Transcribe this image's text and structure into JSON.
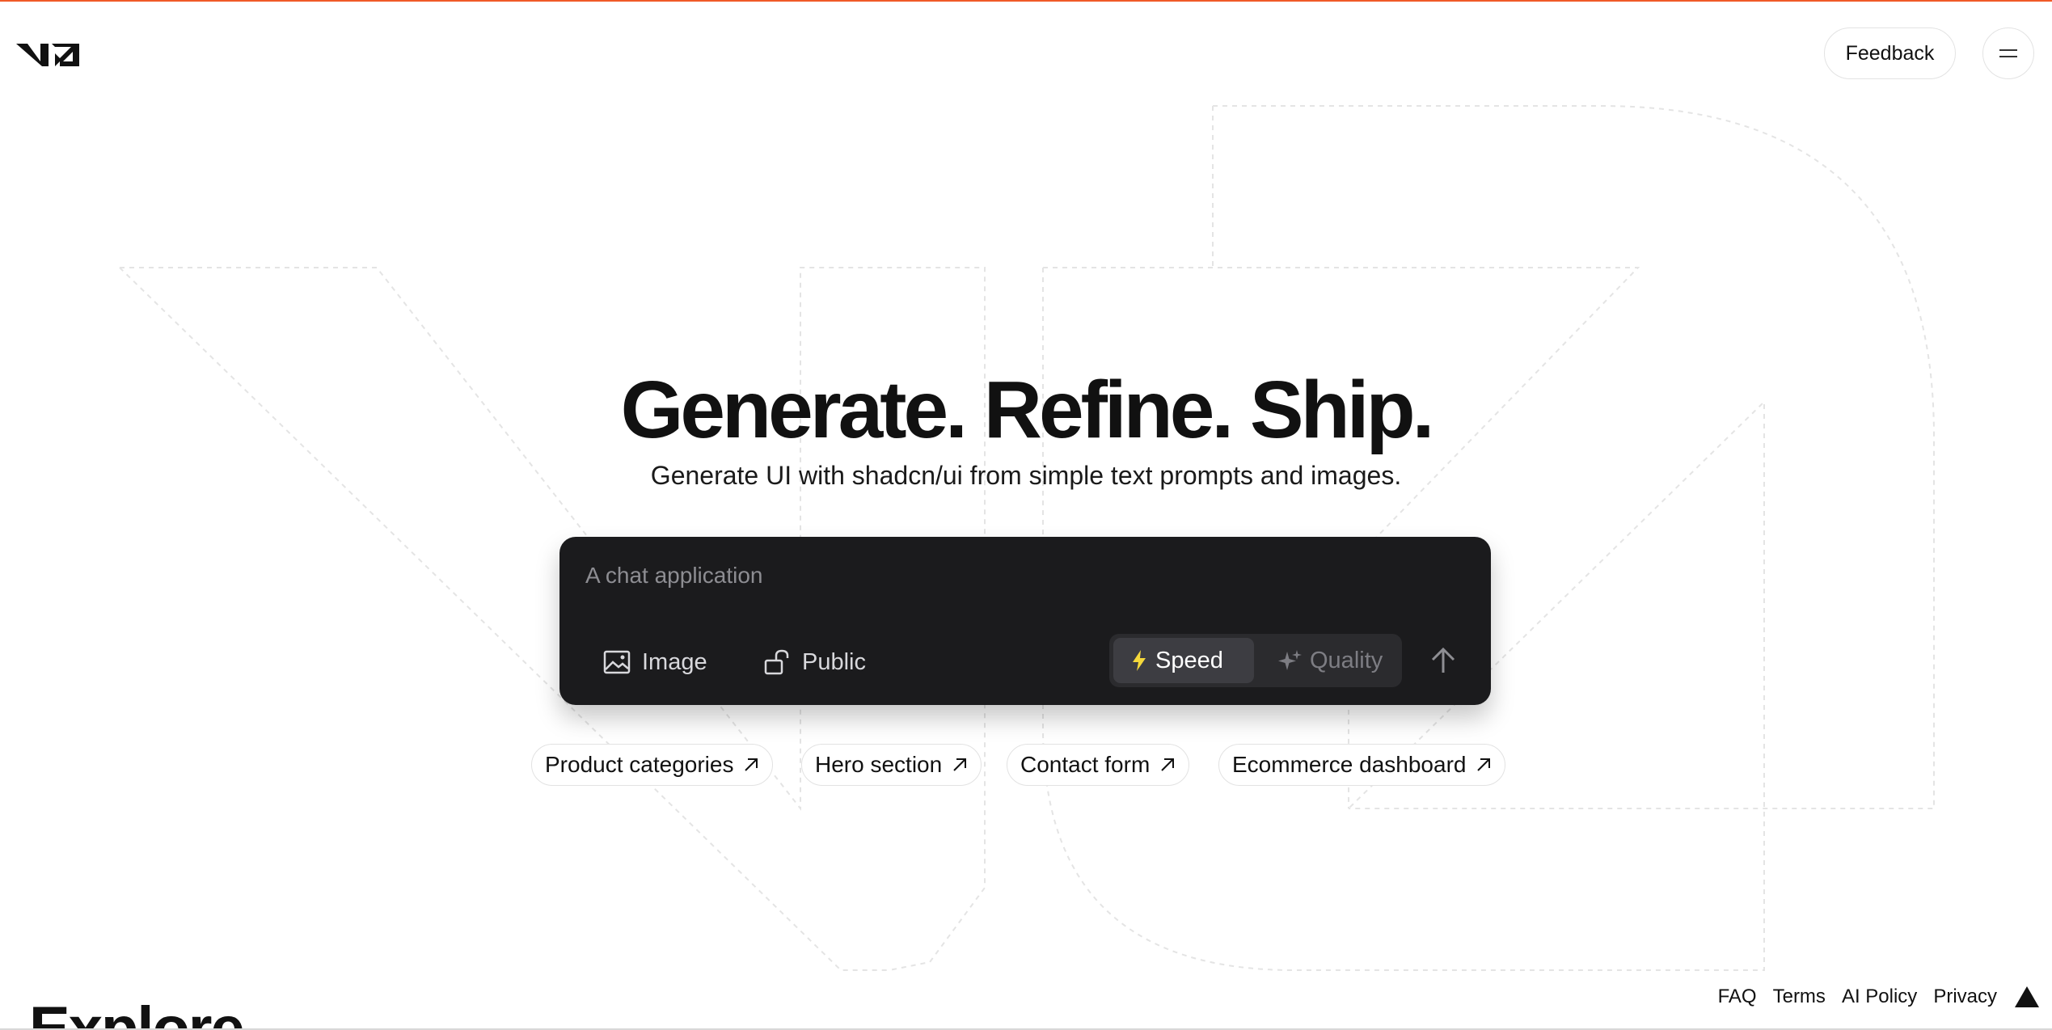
{
  "header": {
    "logo_icon": "v0-logo-icon",
    "feedback_label": "Feedback",
    "menu_icon": "menu-icon"
  },
  "hero": {
    "title": "Generate. Refine. Ship.",
    "subtitle": "Generate UI with shadcn/ui from simple text prompts and images."
  },
  "prompt": {
    "placeholder": "A chat application",
    "value": "",
    "image_label": "Image",
    "image_icon": "image-icon",
    "visibility_label": "Public",
    "visibility_icon": "unlock-icon",
    "modes": [
      {
        "label": "Speed",
        "icon": "lightning-icon",
        "selected": true
      },
      {
        "label": "Quality",
        "icon": "sparkle-icon",
        "selected": false
      }
    ],
    "send_icon": "arrow-up-icon"
  },
  "suggestions": [
    {
      "label": "Product categories",
      "icon": "arrow-up-right-icon"
    },
    {
      "label": "Hero section",
      "icon": "arrow-up-right-icon"
    },
    {
      "label": "Contact form",
      "icon": "arrow-up-right-icon"
    },
    {
      "label": "Ecommerce dashboard",
      "icon": "arrow-up-right-icon"
    }
  ],
  "explore": {
    "heading": "Explore"
  },
  "footer": {
    "links": [
      "FAQ",
      "Terms",
      "AI Policy",
      "Privacy"
    ],
    "brand_icon": "vercel-triangle-icon"
  },
  "colors": {
    "accent_line": "#f05a28",
    "prompt_bg": "#1b1b1d",
    "speed_icon": "#f5d83b",
    "text": "#111111"
  }
}
